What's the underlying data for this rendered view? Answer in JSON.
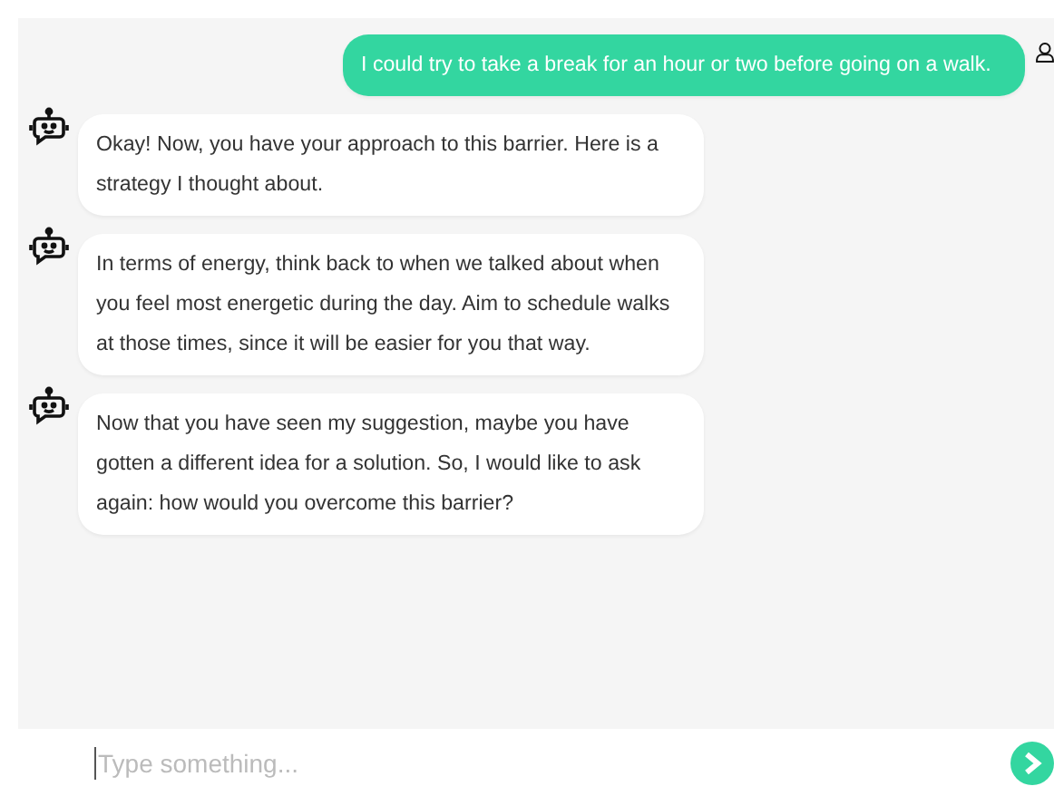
{
  "messages": [
    {
      "kind": "user",
      "text": "I could try to take a break for an hour or two before going on a walk."
    },
    {
      "kind": "bot",
      "text": "Okay! Now, you have your approach to this barrier. Here is a strategy I thought about."
    },
    {
      "kind": "bot",
      "text": "In terms of energy, think back to when we talked about when you feel most energetic during the day. Aim to schedule walks at those times, since it will be easier for you that way."
    },
    {
      "kind": "bot",
      "text": "Now that you have seen my suggestion, maybe you have gotten a different idea for a solution. So, I would like to ask again: how would you overcome this barrier?"
    }
  ],
  "composer": {
    "placeholder": "Type something..."
  }
}
